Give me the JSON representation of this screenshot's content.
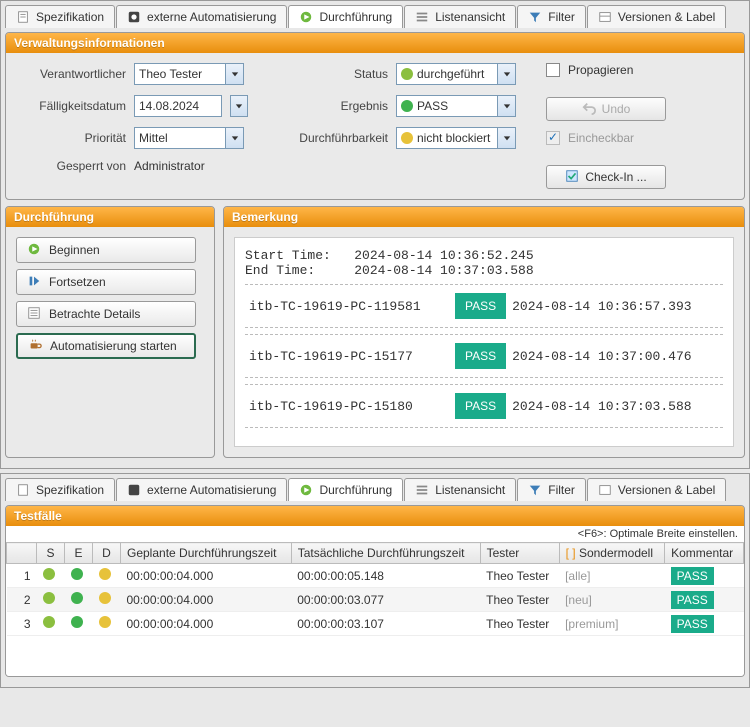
{
  "tabs": {
    "spezifikation": "Spezifikation",
    "automatisierung": "externe Automatisierung",
    "durchfuehrung": "Durchführung",
    "listenansicht": "Listenansicht",
    "filter": "Filter",
    "versionen": "Versionen & Label"
  },
  "admin": {
    "panel_title": "Verwaltungsinformationen",
    "labels": {
      "verantwortlicher": "Verantwortlicher",
      "faelligkeitsdatum": "Fälligkeitsdatum",
      "prioritaet": "Priorität",
      "gesperrt_von": "Gesperrt von",
      "status": "Status",
      "ergebnis": "Ergebnis",
      "durchfuehrbarkeit": "Durchführbarkeit",
      "propagieren": "Propagieren",
      "einchecken": "Eincheckbar",
      "undo": "Undo",
      "checkin": "Check-In ..."
    },
    "values": {
      "verantwortlicher": "Theo Tester",
      "faelligkeitsdatum": "14.08.2024",
      "prioritaet": "Mittel",
      "gesperrt_von": "Administrator",
      "status": "durchgeführt",
      "ergebnis": "PASS",
      "durchfuehrbarkeit": "nicht blockiert"
    },
    "colors": {
      "status": "#8bbf3f",
      "ergebnis": "#3fb24f",
      "durchfuehrbarkeit": "#e7c23a"
    }
  },
  "exec": {
    "panel_title": "Durchführung",
    "buttons": {
      "beginnen": "Beginnen",
      "fortsetzen": "Fortsetzen",
      "details": "Betrachte Details",
      "auto_start": "Automatisierung starten"
    }
  },
  "remark": {
    "panel_title": "Bemerkung",
    "start_label": "Start Time:",
    "end_label": "End Time:",
    "start_time": "2024-08-14 10:36:52.245",
    "end_time": "2024-08-14 10:37:03.588",
    "steps": [
      {
        "id": "itb-TC-19619-PC-119581",
        "result": "PASS",
        "ts": "2024-08-14 10:36:57.393"
      },
      {
        "id": "itb-TC-19619-PC-15177",
        "result": "PASS",
        "ts": "2024-08-14 10:37:00.476"
      },
      {
        "id": "itb-TC-19619-PC-15180",
        "result": "PASS",
        "ts": "2024-08-14 10:37:03.588"
      }
    ]
  },
  "testcases": {
    "panel_title": "Testfälle",
    "hint": "<F6>: Optimale Breite einstellen.",
    "headers": {
      "num": "",
      "s": "S",
      "e": "E",
      "d": "D",
      "planned": "Geplante Durchführungszeit",
      "actual": "Tatsächliche Durchführungszeit",
      "tester": "Tester",
      "sonder": "Sondermodell",
      "kommentar": "Kommentar"
    },
    "rows": [
      {
        "n": "1",
        "planned": "00:00:00:04.000",
        "actual": "00:00:00:05.148",
        "tester": "Theo Tester",
        "sonder": "[alle]",
        "kommentar": "PASS"
      },
      {
        "n": "2",
        "planned": "00:00:00:04.000",
        "actual": "00:00:00:03.077",
        "tester": "Theo Tester",
        "sonder": "[neu]",
        "kommentar": "PASS"
      },
      {
        "n": "3",
        "planned": "00:00:00:04.000",
        "actual": "00:00:00:03.107",
        "tester": "Theo Tester",
        "sonder": "[premium]",
        "kommentar": "PASS"
      }
    ],
    "status_colors": {
      "s": "#8bbf3f",
      "e": "#3fb24f",
      "d": "#e7c23a"
    }
  }
}
